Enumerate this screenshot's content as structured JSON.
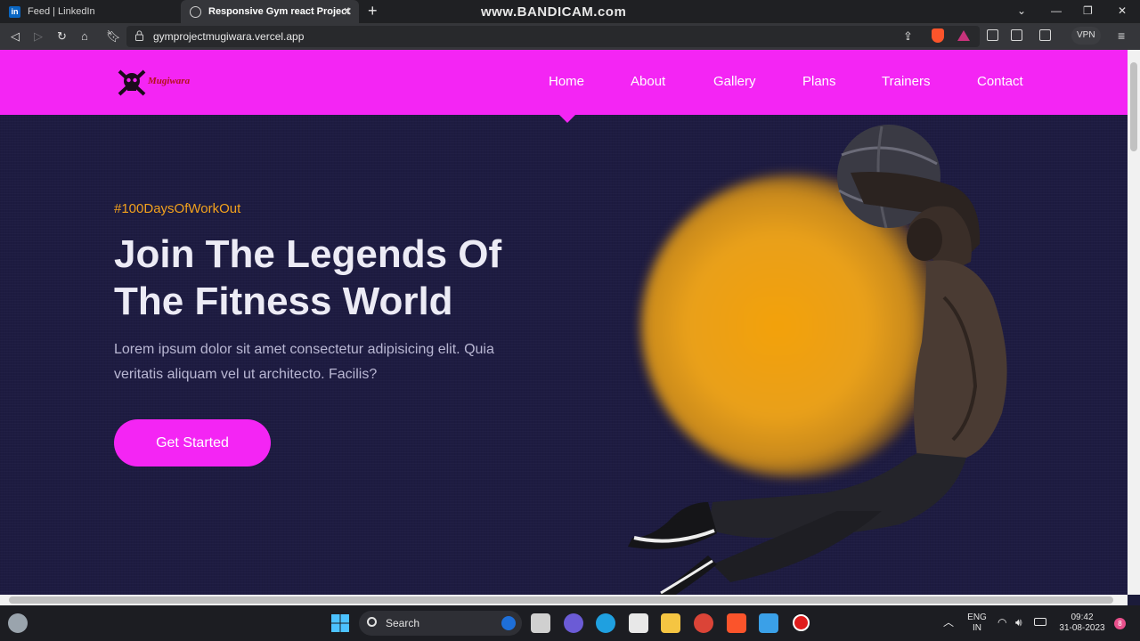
{
  "browser": {
    "tabs": [
      {
        "label": "Feed | LinkedIn",
        "icon": "linkedin-icon"
      },
      {
        "label": "Responsive Gym react Project",
        "icon": "globe-icon",
        "active": true
      }
    ],
    "watermark": "www.BANDICAM.com",
    "url": "gymprojectmugiwara.vercel.app",
    "vpn_label": "VPN"
  },
  "site": {
    "brand": "Mugiwara",
    "nav": [
      "Home",
      "About",
      "Gallery",
      "Plans",
      "Trainers",
      "Contact"
    ],
    "active_nav": "Home",
    "hero": {
      "tag": "#100DaysOfWorkOut",
      "title_line1": "Join The Legends Of",
      "title_line2": "The Fitness World",
      "description": "Lorem ipsum dolor sit amet consectetur adipisicing elit. Quia veritatis aliquam vel ut architecto. Facilis?",
      "cta": "Get Started"
    },
    "colors": {
      "accent": "#f425f4",
      "tag": "#f2a11d",
      "background": "#1d1b41",
      "glow": "#f3a10a"
    }
  },
  "taskbar": {
    "search_placeholder": "Search",
    "language": "ENG",
    "region": "IN",
    "time": "09:42",
    "date": "31-08-2023",
    "notification_count": "8"
  }
}
